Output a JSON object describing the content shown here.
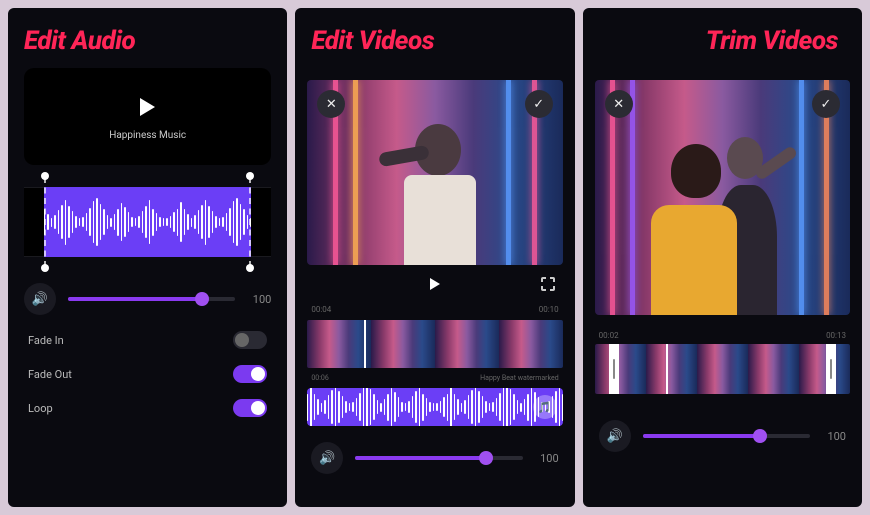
{
  "colors": {
    "accent": "#7b3af0",
    "title": "#ff2557",
    "slider": "#8a3af0"
  },
  "screen1": {
    "title": "Edit Audio",
    "track_name": "Happiness Music",
    "volume": {
      "value": 100,
      "fill_pct": 80
    },
    "toggles": {
      "fade_in": {
        "label": "Fade In",
        "on": false
      },
      "fade_out": {
        "label": "Fade Out",
        "on": true
      },
      "loop": {
        "label": "Loop",
        "on": true
      }
    }
  },
  "screen2": {
    "title": "Edit Videos",
    "time_start": "00:04",
    "time_end": "00:10",
    "timeline_pos": "00:06",
    "audio_name": "Happy Beat watermarked",
    "volume": {
      "value": 100,
      "fill_pct": 78
    }
  },
  "screen3": {
    "title": "Trim Videos",
    "time_start": "00:02",
    "time_end": "00:13",
    "volume": {
      "value": 100,
      "fill_pct": 70
    }
  }
}
